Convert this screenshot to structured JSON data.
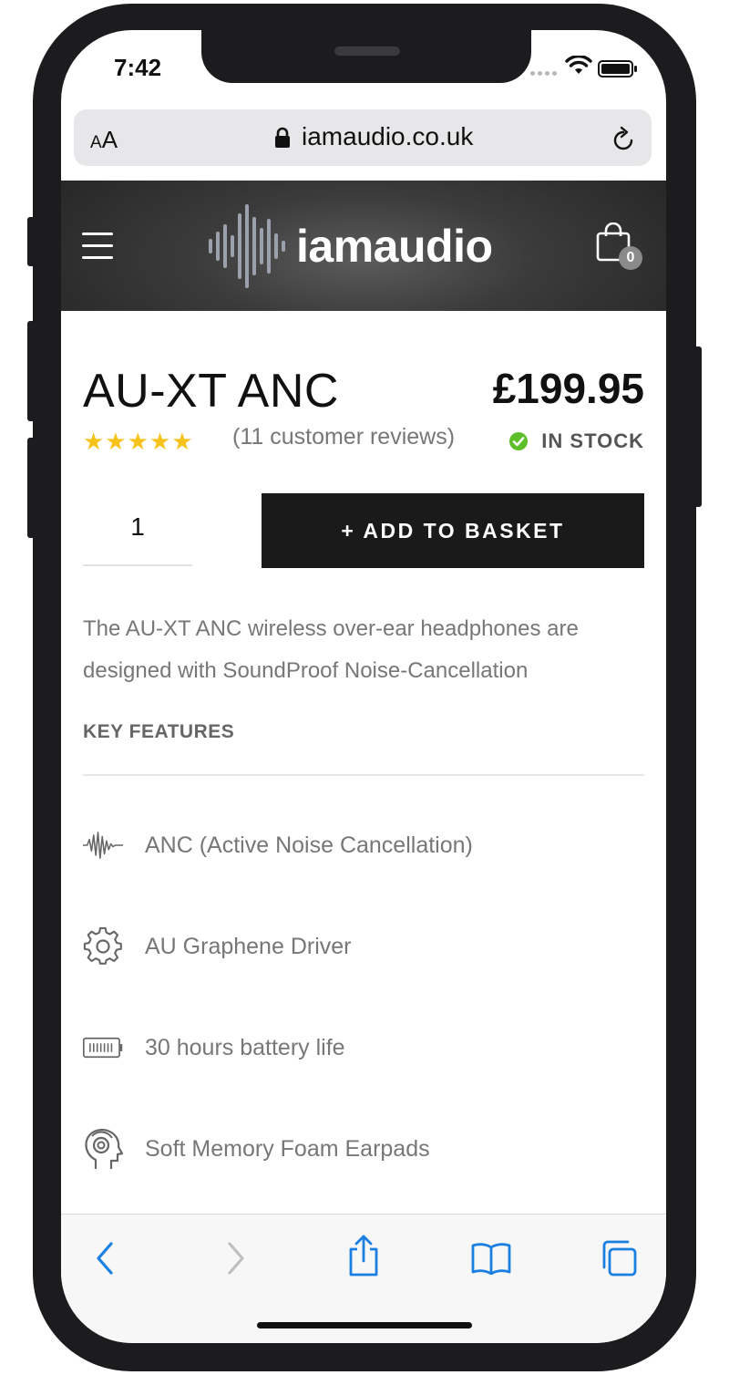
{
  "status_bar": {
    "time": "7:42"
  },
  "browser": {
    "text_size_label_small": "A",
    "text_size_label_large": "A",
    "url": "iamaudio.co.uk"
  },
  "site": {
    "logo_text_first": "i",
    "logo_text_rest": "amaudio",
    "cart_count": "0"
  },
  "product": {
    "title": "AU-XT ANC",
    "price": "£199.95",
    "rating_stars": "★★★★★",
    "rating_value": 5,
    "reviews": "(11 customer reviews)",
    "stock": "IN STOCK",
    "quantity": "1",
    "add_to_basket": "+ ADD TO BASKET",
    "description": "The AU-XT ANC wireless over-ear headphones are designed with SoundProof Noise-Cancellation",
    "key_features_heading": "KEY FEATURES",
    "features": [
      {
        "icon": "waveform-icon",
        "label": "ANC (Active Noise Cancellation)"
      },
      {
        "icon": "gear-icon",
        "label": "AU Graphene Driver"
      },
      {
        "icon": "battery-icon",
        "label": "30 hours battery life"
      },
      {
        "icon": "head-earpad-icon",
        "label": "Soft Memory Foam Earpads"
      }
    ]
  },
  "colors": {
    "accent_blue": "#1a7fe0",
    "star": "#f6c21c",
    "stock_green": "#5cbf2a",
    "button_dark": "#1a1a1a"
  }
}
